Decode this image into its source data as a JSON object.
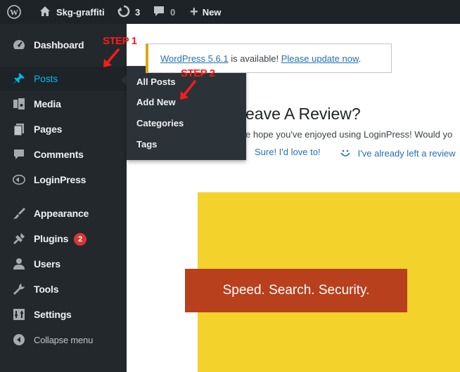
{
  "adminbar": {
    "site_name": "Skg-graffiti",
    "updates_count": "3",
    "comments_count": "0",
    "new_label": "New"
  },
  "sidebar": {
    "items": [
      {
        "label": "Dashboard",
        "icon": "dashboard-icon"
      },
      {
        "label": "Posts",
        "icon": "pin-icon"
      },
      {
        "label": "Media",
        "icon": "media-icon"
      },
      {
        "label": "Pages",
        "icon": "pages-icon"
      },
      {
        "label": "Comments",
        "icon": "comment-icon"
      },
      {
        "label": "LoginPress",
        "icon": "loginpress-icon"
      },
      {
        "label": "Appearance",
        "icon": "brush-icon"
      },
      {
        "label": "Plugins",
        "icon": "plugin-icon",
        "badge": "2"
      },
      {
        "label": "Users",
        "icon": "users-icon"
      },
      {
        "label": "Tools",
        "icon": "wrench-icon"
      },
      {
        "label": "Settings",
        "icon": "settings-icon"
      },
      {
        "label": "Collapse menu",
        "icon": "collapse-icon"
      }
    ]
  },
  "submenu": {
    "items": [
      "All Posts",
      "Add New",
      "Categories",
      "Tags"
    ]
  },
  "notice": {
    "version_link": "WordPress 5.6.1",
    "middle_text": " is available! ",
    "update_link": "Please update now",
    "end_text": "."
  },
  "review": {
    "title": "eave A Review?",
    "text": "e hope you've enjoyed using LoginPress! Would yo",
    "link_sure": "Sure! I'd love to!",
    "link_already": "I've already left a review"
  },
  "banner": {
    "text": "Speed. Search. Security."
  },
  "annotations": {
    "step1": "STEP 1",
    "step2": "STEP 2"
  },
  "colors": {
    "sidebar_bg": "#23282d",
    "adminbar_bg": "#1d2327",
    "hover_accent": "#00b9eb",
    "notice_border": "#dba617",
    "banner_yellow": "#f3d22b",
    "banner_red": "#b8401c",
    "step_red": "#ff1a1a"
  }
}
